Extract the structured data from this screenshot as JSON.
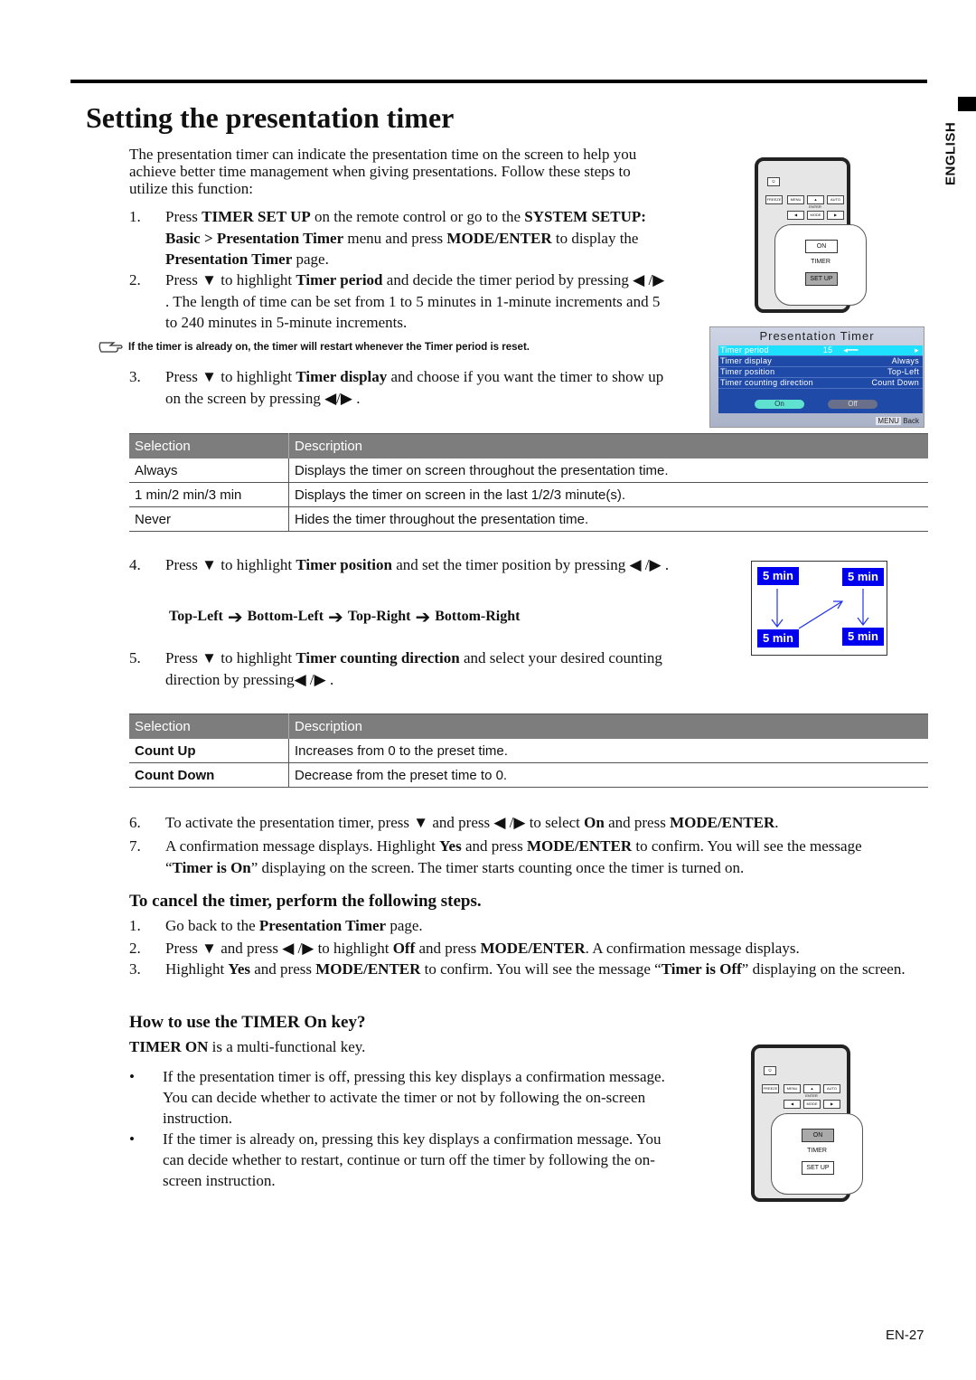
{
  "page": {
    "title": "Setting the presentation timer",
    "language_tab": "ENGLISH",
    "page_number": "EN-27"
  },
  "intro": "The presentation timer can indicate the presentation time on the screen to help you achieve better time management when giving presentations. Follow these steps to utilize this function:",
  "steps": [
    {
      "num": "1.",
      "parts": [
        [
          "Press ",
          false
        ],
        [
          "TIMER SET UP",
          true
        ],
        [
          " on the remote control or go to the ",
          false
        ],
        [
          "SYSTEM SETUP: Basic > Presentation Timer",
          true
        ],
        [
          " menu and press ",
          false
        ],
        [
          "MODE/ENTER",
          true
        ],
        [
          " to display the ",
          false
        ],
        [
          "Presentation Timer",
          true
        ],
        [
          " page.",
          false
        ]
      ]
    },
    {
      "num": "2.",
      "parts": [
        [
          "Press ▼ to highlight ",
          false
        ],
        [
          "Timer period",
          true
        ],
        [
          " and decide the timer period by pressing ◀ /▶ . The length of time can be set from 1 to 5 minutes in 1-minute increments and 5 to 240 minutes in 5-minute increments.",
          false
        ]
      ]
    },
    {
      "num": "3.",
      "parts": [
        [
          "Press ▼ to highlight ",
          false
        ],
        [
          "Timer display",
          true
        ],
        [
          " and choose if you want the timer to show up on the screen by pressing ◀/▶ .",
          false
        ]
      ]
    },
    {
      "num": "4.",
      "parts": [
        [
          "Press ▼ to highlight ",
          false
        ],
        [
          "Timer position",
          true
        ],
        [
          " and set the timer position by pressing ◀ /▶ .",
          false
        ]
      ]
    },
    {
      "num": "5.",
      "parts": [
        [
          "Press ▼ to highlight ",
          false
        ],
        [
          "Timer counting direction",
          true
        ],
        [
          " and select your desired counting direction by pressing◀ /▶ .",
          false
        ]
      ]
    },
    {
      "num": "6.",
      "parts": [
        [
          "To activate the presentation timer, press ▼ and press ◀ /▶ to select ",
          false
        ],
        [
          "On",
          true
        ],
        [
          " and press ",
          false
        ],
        [
          "MODE/ENTER",
          true
        ],
        [
          ".",
          false
        ]
      ]
    },
    {
      "num": "7.",
      "parts": [
        [
          "A confirmation message displays. Highlight ",
          false
        ],
        [
          "Yes",
          true
        ],
        [
          " and press ",
          false
        ],
        [
          "MODE/ENTER",
          true
        ],
        [
          " to confirm. You will see the message “",
          false
        ],
        [
          "Timer is On",
          true
        ],
        [
          "” displaying on the  screen. The timer starts counting once the timer is turned on.",
          false
        ]
      ]
    }
  ],
  "note": "If the timer is already on, the timer will restart whenever the Timer period is reset.",
  "display_table": {
    "headers": [
      "Selection",
      "Description"
    ],
    "rows": [
      [
        "Always",
        "Displays the timer on screen throughout the presentation time."
      ],
      [
        "1 min/2 min/3 min",
        "Displays the timer on screen in the last 1/2/3 minute(s)."
      ],
      [
        "Never",
        "Hides the timer throughout the presentation time."
      ]
    ]
  },
  "position_sequence": [
    "Top-Left",
    "Bottom-Left",
    "Top-Right",
    "Bottom-Right"
  ],
  "position_diagram": {
    "label": "5 min"
  },
  "direction_table": {
    "headers": [
      "Selection",
      "Description"
    ],
    "rows": [
      [
        "Count Up",
        "Increases from 0 to the preset time."
      ],
      [
        "Count Down",
        "Decrease from the preset time to 0."
      ]
    ]
  },
  "cancel": {
    "heading": "To cancel the timer, perform the following steps.",
    "steps": [
      {
        "num": "1.",
        "parts": [
          [
            "Go back to the ",
            false
          ],
          [
            "Presentation Timer",
            true
          ],
          [
            " page.",
            false
          ]
        ]
      },
      {
        "num": "2.",
        "parts": [
          [
            "Press ▼ and press ◀ /▶ to highlight ",
            false
          ],
          [
            "Off",
            true
          ],
          [
            " and press ",
            false
          ],
          [
            "MODE/ENTER",
            true
          ],
          [
            ". A confirmation message displays.",
            false
          ]
        ]
      },
      {
        "num": "3.",
        "parts": [
          [
            "Highlight ",
            false
          ],
          [
            "Yes",
            true
          ],
          [
            " and press ",
            false
          ],
          [
            "MODE/ENTER",
            true
          ],
          [
            " to confirm. You will see the message “",
            false
          ],
          [
            "Timer is Off",
            true
          ],
          [
            "” displaying on the screen.",
            false
          ]
        ]
      }
    ]
  },
  "timer_on": {
    "heading": "How to use the TIMER On key?",
    "lead_bold": "TIMER ON",
    "lead_rest": " is a multi-functional key.",
    "bullets": [
      "If the presentation timer is off, pressing this key displays a confirmation message. You can decide whether to activate the timer or not by following the on-screen instruction.",
      "If the timer is already on, pressing this key displays a confirmation message. You can decide whether to restart, continue or turn off the timer by following the on-screen instruction."
    ]
  },
  "osd": {
    "title": "Presentation Timer",
    "rows": [
      {
        "label": "Timer period",
        "value": "15",
        "highlighted": true
      },
      {
        "label": "Timer display",
        "value": "Always"
      },
      {
        "label": "Timer position",
        "value": "Top-Left"
      },
      {
        "label": "Timer counting direction",
        "value": "Count Down"
      }
    ],
    "on_label": "On",
    "off_label": "Off",
    "menu_key": "MENU",
    "back_label": "Back"
  },
  "remote": {
    "buttons": [
      "FREEZE",
      "MENU",
      "▲",
      "AUTO",
      "◀",
      "MODE",
      "▶"
    ],
    "enter_label": "ENTER",
    "on_label": "ON",
    "timer_label": "TIMER",
    "setup_label": "SET UP"
  }
}
